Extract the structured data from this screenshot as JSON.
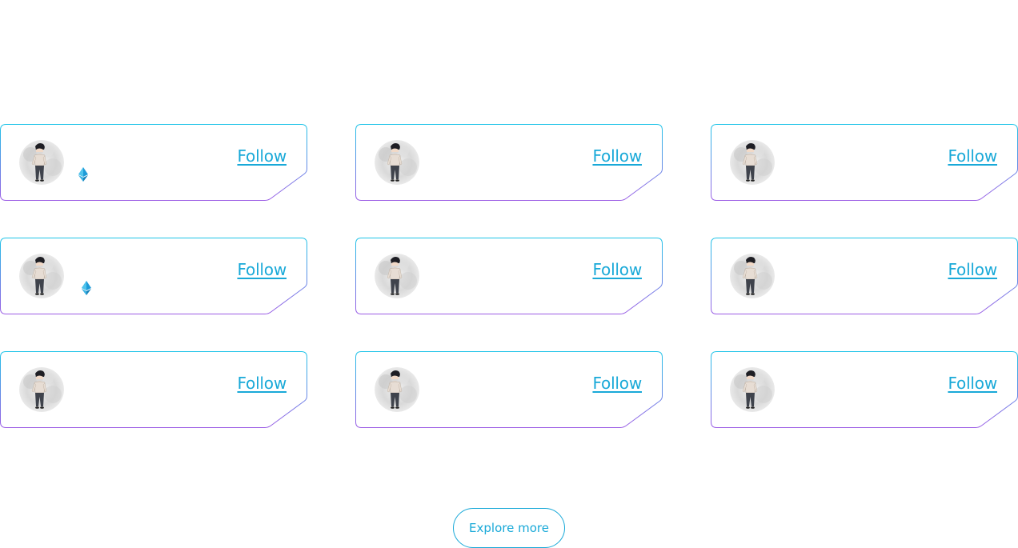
{
  "accent_color": "#19a9d8",
  "border_gradient": [
    "#1fc4e8",
    "#9b5de5"
  ],
  "creators": [
    {
      "follow_label": "Follow",
      "avatar_icon": "avatar-icon",
      "badge_icon": "ethereum-icon"
    },
    {
      "follow_label": "Follow",
      "avatar_icon": "avatar-icon",
      "badge_icon": null
    },
    {
      "follow_label": "Follow",
      "avatar_icon": "avatar-icon",
      "badge_icon": null
    },
    {
      "follow_label": "Follow",
      "avatar_icon": "avatar-icon",
      "badge_icon": "ethereum-icon"
    },
    {
      "follow_label": "Follow",
      "avatar_icon": "avatar-icon",
      "badge_icon": null
    },
    {
      "follow_label": "Follow",
      "avatar_icon": "avatar-icon",
      "badge_icon": null
    },
    {
      "follow_label": "Follow",
      "avatar_icon": "avatar-icon",
      "badge_icon": null
    },
    {
      "follow_label": "Follow",
      "avatar_icon": "avatar-icon",
      "badge_icon": null
    },
    {
      "follow_label": "Follow",
      "avatar_icon": "avatar-icon",
      "badge_icon": null
    }
  ],
  "explore_button": {
    "label": "Explore more"
  }
}
